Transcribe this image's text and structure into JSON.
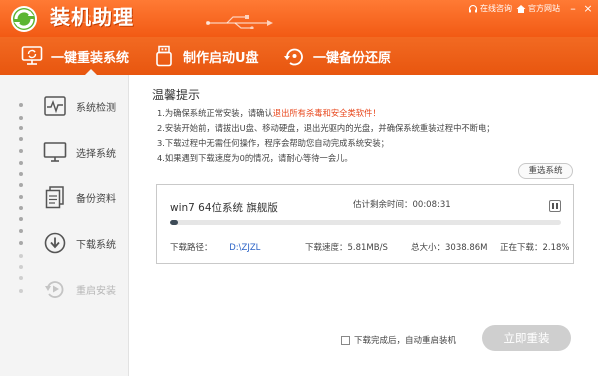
{
  "app": {
    "title": "装机助理",
    "brand_color": "#f25a14"
  },
  "topbar": {
    "online_help": "在线咨询",
    "official_site": "官方网站",
    "minimize": "–",
    "close": "×"
  },
  "tabs": [
    {
      "label": "一键重装系统",
      "icon": "monitor-refresh-icon",
      "active": true
    },
    {
      "label": "制作启动U盘",
      "icon": "usb-drive-icon",
      "active": false
    },
    {
      "label": "一键备份还原",
      "icon": "backup-restore-icon",
      "active": false
    }
  ],
  "steps": [
    {
      "label": "系统检测",
      "icon": "pulse-monitor-icon",
      "enabled": true
    },
    {
      "label": "选择系统",
      "icon": "desktop-icon",
      "enabled": true
    },
    {
      "label": "备份资料",
      "icon": "documents-icon",
      "enabled": true
    },
    {
      "label": "下载系统",
      "icon": "download-icon",
      "enabled": true
    },
    {
      "label": "重启安装",
      "icon": "restart-icon",
      "enabled": false
    }
  ],
  "notice": {
    "title": "温馨提示",
    "line1_prefix": "1.为确保系统正常安装，请确认",
    "line1_highlight": "退出所有杀毒和安全类软件！",
    "line2": "2.安装开始前，请拔出U盘、移动硬盘，退出光驱内的光盘，并确保系统重装过程中不断电；",
    "line3": "3.下载过程中无需任何操作，程序会帮助您自动完成系统安装；",
    "line4": "4.如果遇到下载速度为0的情况，请耐心等待一会儿。",
    "highlight_color": "#e8451a"
  },
  "reselect_button": "重选系统",
  "download": {
    "system_name": "win7 64位系统 旗舰版",
    "time_remaining_label": "估计剩余时间：00:08:31",
    "progress": 0.02,
    "path_label": "下载路径：",
    "path_value": "D:\\ZJZL",
    "speed": "下载速度：5.81MB/S",
    "total_size": "总大小：3038.86M",
    "downloading": "正在下载：2.18%"
  },
  "auto_restart_label": "下载完成后，自动重启装机",
  "install_button": "立即重装"
}
